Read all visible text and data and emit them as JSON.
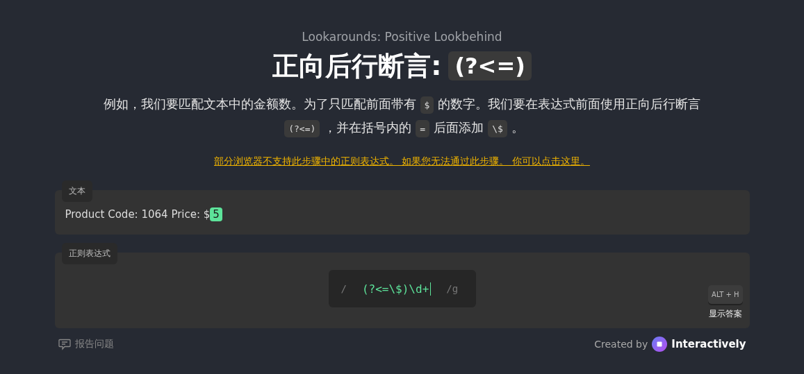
{
  "subtitle": "Lookarounds: Positive Lookbehind",
  "title": {
    "text": "正向后行断言:",
    "code": "(?<=)"
  },
  "description": [
    {
      "kind": "text",
      "text": "例如，我们要匹配文本中的金额数。为了只匹配前面带有"
    },
    {
      "kind": "code",
      "text": "$"
    },
    {
      "kind": "text",
      "text": "的数字。我们要在表达式前面使用正向后行断言"
    },
    {
      "kind": "code",
      "text": "(?<=)"
    },
    {
      "kind": "text",
      "text": "，并在括号内的"
    },
    {
      "kind": "code",
      "text": "="
    },
    {
      "kind": "text",
      "text": "后面添加"
    },
    {
      "kind": "code",
      "text": "\\$"
    },
    {
      "kind": "text",
      "text": "。"
    }
  ],
  "warning_link": "部分浏览器不支持此步骤中的正则表达式。 如果您无法通过此步骤。 你可以点击这里。",
  "text_panel": {
    "label": "文本",
    "segments": [
      {
        "text": "Product Code: 1064 Price: $",
        "matched": false
      },
      {
        "text": "5",
        "matched": true
      }
    ]
  },
  "regex_panel": {
    "label": "正则表达式",
    "prefix": "/",
    "value": "(?<=\\$)\\d+",
    "suffix": "/g",
    "shortcut": "ALT + H",
    "answer_label": "显示答案"
  },
  "footer": {
    "report": "报告问题",
    "created_by": "Created by",
    "brand": "Interactively"
  }
}
